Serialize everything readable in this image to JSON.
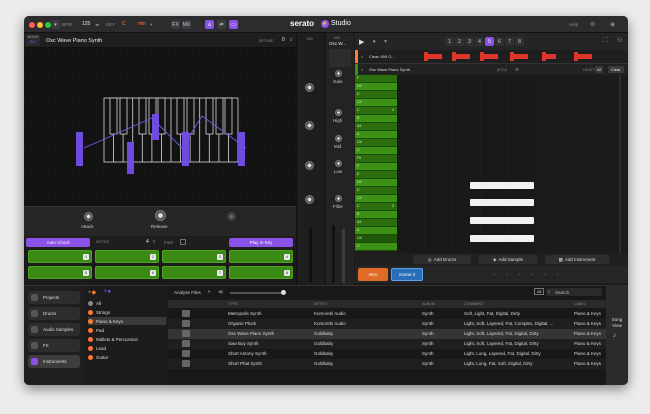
{
  "topbar": {
    "bpm_label": "BPM",
    "bpm_value": "125",
    "key_label": "KEY",
    "key_note": "C",
    "key_mode": "min",
    "fx_label": "FX",
    "mix_label": "MX",
    "brand_name": "serato",
    "brand_studio": "Studio",
    "help_label": "Help"
  },
  "synth": {
    "mode": "MONO",
    "poly": "PLY",
    "name": "Osc Wave Piano Synth",
    "tune_label": "RETUNE",
    "tune_value": "0",
    "attack_label": "Attack",
    "release_label": "Release",
    "auto_chord_label": "Auto Chord",
    "notes_label": "NOTES",
    "notes_value": "4",
    "fast_label": "Fast",
    "play_in_key_label": "Play In Key",
    "pad_numbers": [
      "1",
      "2",
      "3",
      "4",
      "5",
      "6",
      "7",
      "8"
    ]
  },
  "mixer": {
    "col1_label": "MIX",
    "col2_label": "MIX",
    "col2_name": "Osc W...",
    "knobs": [
      "Gain",
      "High",
      "Mid",
      "Low",
      "Filter"
    ]
  },
  "sequencer": {
    "pattern_numbers": [
      "1",
      "2",
      "3",
      "4",
      "5",
      "6",
      "7",
      "8"
    ],
    "selected_pattern": "5",
    "track1_name": "Clean 909 O...",
    "track2_name": "Osc Wave Piano Synth",
    "track2_length_label": "LENGTH",
    "track2_length_value": "x2",
    "clear_label": "Clear",
    "keys": [
      "F",
      "D#",
      "D",
      "C#",
      "C",
      "B",
      "A#",
      "A",
      "G#",
      "G",
      "F#",
      "F",
      "E",
      "D#",
      "D",
      "C#",
      "C",
      "B",
      "A#",
      "A",
      "G#",
      "G",
      "F#",
      "F"
    ],
    "key_octave_label": "4",
    "key_octave_label2": "3",
    "add_drums": "Add Drums",
    "add_sample": "Add Sample",
    "add_instrument": "Add Instrument",
    "scenes": [
      "Intro",
      "Scene 2"
    ]
  },
  "library": {
    "sidebar": [
      "Projects",
      "Drums",
      "Audio Samples",
      "FX",
      "Instruments"
    ],
    "selected_sidebar": "Instruments",
    "categories": [
      "All",
      "Strings",
      "Piano & Keys",
      "Pad",
      "Mallets & Percussion",
      "Lead",
      "Guitar"
    ],
    "selected_category": "Piano & Keys",
    "analyse_label": "Analyse Files",
    "search_placeholder": "Search",
    "search_all": "All",
    "columns": [
      "TYPE",
      "ARTIST",
      "ALBUM",
      "COMMENT",
      "LABEL"
    ],
    "rows": [
      {
        "name": "Metropolis Synth",
        "artist": "Komorebi Audio",
        "album": "Synth",
        "comment": "Soft, Light, Fat, Digital, Dirty",
        "label": "Piano & Keys"
      },
      {
        "name": "Organic Pluck",
        "artist": "Komorebi Audio",
        "album": "Synth",
        "comment": "Light, Soft, Layered, Fat, Complex, Digital, ...",
        "label": "Piano & Keys"
      },
      {
        "name": "Osc Wave Piano Synth",
        "artist": "Goldbaby",
        "album": "Synth",
        "comment": "Light, Soft, Layered, Fat, Digital, Dirty",
        "label": "Piano & Keys"
      },
      {
        "name": "Saw Boy Synth",
        "artist": "Goldbaby",
        "album": "Synth",
        "comment": "Light, Soft, Layered, Fat, Digital, Dirty",
        "label": "Piano & Keys"
      },
      {
        "name": "Short Antony Synth",
        "artist": "Goldbaby",
        "album": "Synth",
        "comment": "Light, Long, Layered, Fat, Digital, Dirty",
        "label": "Piano & Keys"
      },
      {
        "name": "Short Phat Synth",
        "artist": "Goldbaby",
        "album": "Synth",
        "comment": "Light, Long, Fat, Soft, Digital, Dirty",
        "label": "Piano & Keys"
      }
    ],
    "selected_row": 2,
    "song_view_label": "Song View"
  },
  "colors": {
    "accent": "#8a52e8",
    "orange": "#ff7a2f",
    "green": "#3d9215"
  }
}
